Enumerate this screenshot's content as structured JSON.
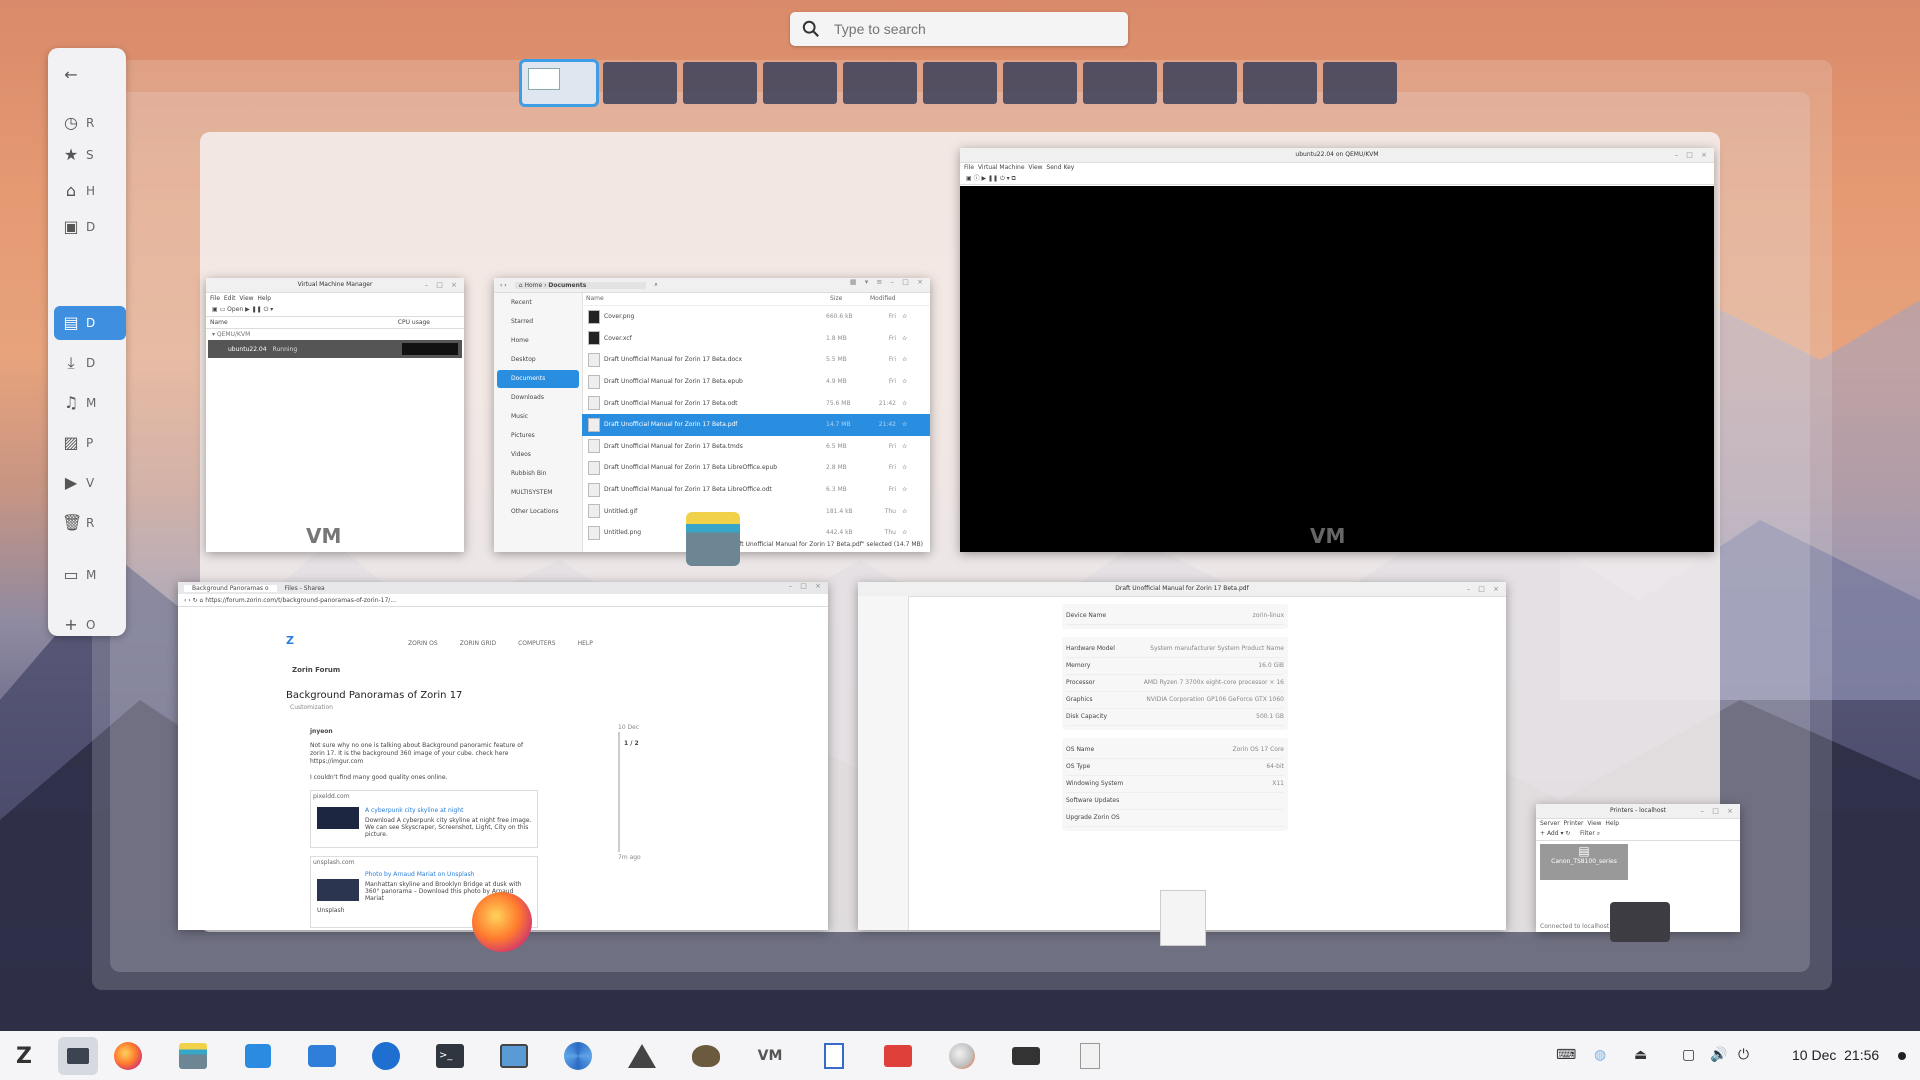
{
  "search": {
    "placeholder": "Type to search"
  },
  "left_sidebar": {
    "items": [
      "R",
      "S",
      "H",
      "D",
      "D",
      "D",
      "M",
      "P",
      "V",
      "R",
      "M",
      "O"
    ]
  },
  "vmm_window": {
    "title": "Virtual Machine Manager",
    "menu": [
      "File",
      "Edit",
      "View",
      "Help"
    ],
    "toolbar_open": "Open",
    "col_name": "Name",
    "col_cpu": "CPU usage",
    "group": "QEMU/KVM",
    "vm_name": "ubuntu22.04",
    "vm_status": "Running"
  },
  "files_window": {
    "path_home": "Home",
    "path_current": "Documents",
    "sidebar": [
      "Recent",
      "Starred",
      "Home",
      "Desktop",
      "Documents",
      "Downloads",
      "Music",
      "Pictures",
      "Videos",
      "Rubbish Bin",
      "MULTISYSTEM",
      "Other Locations"
    ],
    "col_name": "Name",
    "col_size": "Size",
    "col_modified": "Modified",
    "files": [
      {
        "name": "Cover.png",
        "size": "660.6 kB",
        "modified": "Fri"
      },
      {
        "name": "Cover.xcf",
        "size": "1.8 MB",
        "modified": "Fri"
      },
      {
        "name": "Draft Unofficial Manual for Zorin 17 Beta.docx",
        "size": "5.5 MB",
        "modified": "Fri"
      },
      {
        "name": "Draft Unofficial Manual for Zorin 17 Beta.epub",
        "size": "4.9 MB",
        "modified": "Fri"
      },
      {
        "name": "Draft Unofficial Manual for Zorin 17 Beta.odt",
        "size": "75.6 MB",
        "modified": "21:42"
      },
      {
        "name": "Draft Unofficial Manual for Zorin 17 Beta.pdf",
        "size": "14.7 MB",
        "modified": "21:42"
      },
      {
        "name": "Draft Unofficial Manual for Zorin 17 Beta.tmds",
        "size": "6.5 MB",
        "modified": "Fri"
      },
      {
        "name": "Draft Unofficial Manual for Zorin 17 Beta LibreOffice.epub",
        "size": "2.8 MB",
        "modified": "Fri"
      },
      {
        "name": "Draft Unofficial Manual for Zorin 17 Beta LibreOffice.odt",
        "size": "6.3 MB",
        "modified": "Fri"
      },
      {
        "name": "Untitled.gif",
        "size": "181.4 kB",
        "modified": "Thu"
      },
      {
        "name": "Untitled.png",
        "size": "442.4 kB",
        "modified": "Thu"
      }
    ],
    "status": "\"Draft Unofficial Manual for Zorin 17 Beta.pdf\" selected (14.7 MB)"
  },
  "vm_display": {
    "title": "ubuntu22.04 on QEMU/KVM",
    "menu": [
      "File",
      "Virtual Machine",
      "View",
      "Send Key"
    ]
  },
  "browser_window": {
    "tab1": "Background Panoramas o",
    "tab2": "Files - Sharea",
    "url": "https://forum.zorin.com/t/background-panoramas-of-zorin-17/...",
    "nav": [
      "ZORIN OS",
      "ZORIN GRID",
      "COMPUTERS",
      "HELP"
    ],
    "forum_title": "Zorin Forum",
    "topic_title": "Background Panoramas of Zorin 17",
    "category": "Customization",
    "user": "jnyeon",
    "post_line1": "Not sure why no one is talking about Background panoramic feature of zorin 17. It is the background 360 image of your cube. check here https://imgur.com",
    "post_line2": "I couldn't find many good quality ones online.",
    "card1_site": "pixeldd.com",
    "card1_title": "A cyberpunk city skyline at night",
    "card1_desc": "Download A cyberpunk city skyline at night free image. We can see Skyscraper, Screenshot, Light, City on this picture.",
    "card2_site": "unsplash.com",
    "card2_title": "Photo by Arnaud Mariat on Unsplash",
    "card2_desc": "Manhattan skyline and Brooklyn Bridge at dusk with 360° panorama – Download this photo by Arnaud Mariat",
    "card2_footer": "Unsplash",
    "timeline_top": "10 Dec",
    "timeline_pos": "1 / 2",
    "timeline_bottom": "7m ago"
  },
  "about_window": {
    "title": "Draft Unofficial Manual for Zorin 17 Beta.pdf",
    "rows1": [
      [
        "Device Name",
        "zorin-linux"
      ]
    ],
    "rows2": [
      [
        "Hardware Model",
        "System manufacturer System Product Name"
      ],
      [
        "Memory",
        "16.0 GiB"
      ],
      [
        "Processor",
        "AMD Ryzen 7 3700x eight-core processor × 16"
      ],
      [
        "Graphics",
        "NVIDIA Corporation GP106 GeForce GTX 1060"
      ],
      [
        "Disk Capacity",
        "500.1 GB"
      ]
    ],
    "rows3": [
      [
        "OS Name",
        "Zorin OS 17 Core"
      ],
      [
        "OS Type",
        "64-bit"
      ],
      [
        "Windowing System",
        "X11"
      ],
      [
        "Software Updates",
        ""
      ],
      [
        "Upgrade Zorin OS",
        ""
      ]
    ]
  },
  "printers_window": {
    "title": "Printers - localhost",
    "menu": [
      "Server",
      "Printer",
      "View",
      "Help"
    ],
    "add": "Add",
    "filter": "Filter",
    "printer": "Canon_TS8100_series",
    "status": "Connected to localhost"
  },
  "clock": {
    "date": "10 Dec",
    "time": "21:56"
  }
}
